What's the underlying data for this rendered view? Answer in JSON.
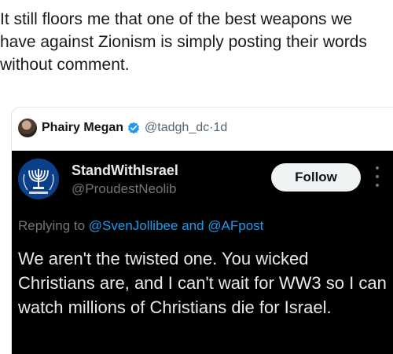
{
  "caption": {
    "text": "It still floors me that one of the best weapons we have against Zionism is simply posting their words without comment."
  },
  "outer_tweet": {
    "name": "Phairy Megan",
    "handle": "@tadgh_dc",
    "separator": "·",
    "time": "1d",
    "verified_color": "#1d9bf0"
  },
  "quoted_tweet": {
    "name": "StandWithIsrael",
    "handle": "@ProudestNeolib",
    "follow_label": "Follow",
    "reply_prefix": "Replying to",
    "reply_to_1": "@SvenJollibee",
    "reply_and": "and",
    "reply_to_2": "@AFpost",
    "body": "We aren't the twisted one. You wicked Christians are, and I can't wait for WW3 so I can watch millions of Christians die for Israel.",
    "avatar_icon": "menorah-emblem-icon",
    "link_color": "#1d9bf0"
  }
}
